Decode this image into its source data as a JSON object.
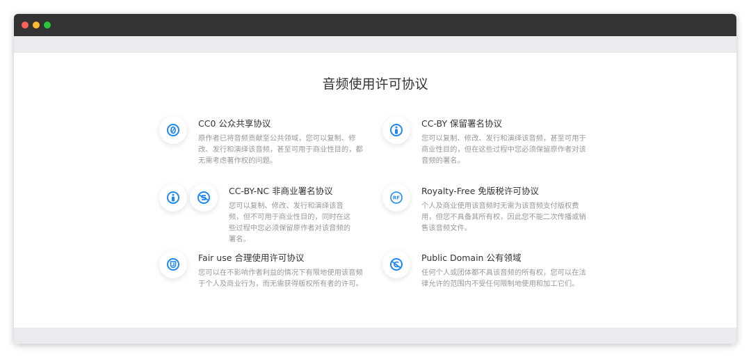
{
  "page": {
    "title": "音频使用许可协议"
  },
  "colors": {
    "accent": "#1e88f5",
    "titlebar": "#333333"
  },
  "items": [
    {
      "title": "CC0 公众共享协议",
      "desc": "原作者已将音频贡献至公共领域，您可以复制、修改、发行和演绎该音频，甚至可用于商业性目的，都无需考虑著作权的问题。",
      "icons": [
        "cc0-icon"
      ]
    },
    {
      "title": "CC-BY 保留署名协议",
      "desc": "您可以复制、修改、发行和演绎该音频，甚至可用于商业性目的，但在这些过程中您必须保留原作者对该音频的署名。",
      "icons": [
        "attribution-icon"
      ]
    },
    {
      "title": "CC-BY-NC 非商业署名协议",
      "desc": "您可以复制、修改、发行和演绎该音频，但不可用于商业性目的，同时在这些过程中您必须保留原作者对该音频的署名。",
      "icons": [
        "attribution-icon",
        "non-commercial-icon"
      ]
    },
    {
      "title": "Royalty-Free 免版税许可协议",
      "desc": "个人及商业使用该音频时无需为该音频支付版权费用，但您不具备其所有权，因此您不能二次传播或销售该音频文件。",
      "icons": [
        "rf-icon"
      ],
      "icon_text": "RF"
    },
    {
      "title": "Fair use 合理使用许可协议",
      "desc": "您可以在不影响作者利益的情况下有限地使用该音频于个人及商业行为，而无需获得版权所有者的许可。",
      "icons": [
        "fair-use-icon"
      ]
    },
    {
      "title": "Public Domain 公有领域",
      "desc": "任何个人或团体都不具该音频的所有权，您可以在法律允许的范围内不受任何限制地使用和加工它们。",
      "icons": [
        "public-domain-icon"
      ]
    }
  ]
}
